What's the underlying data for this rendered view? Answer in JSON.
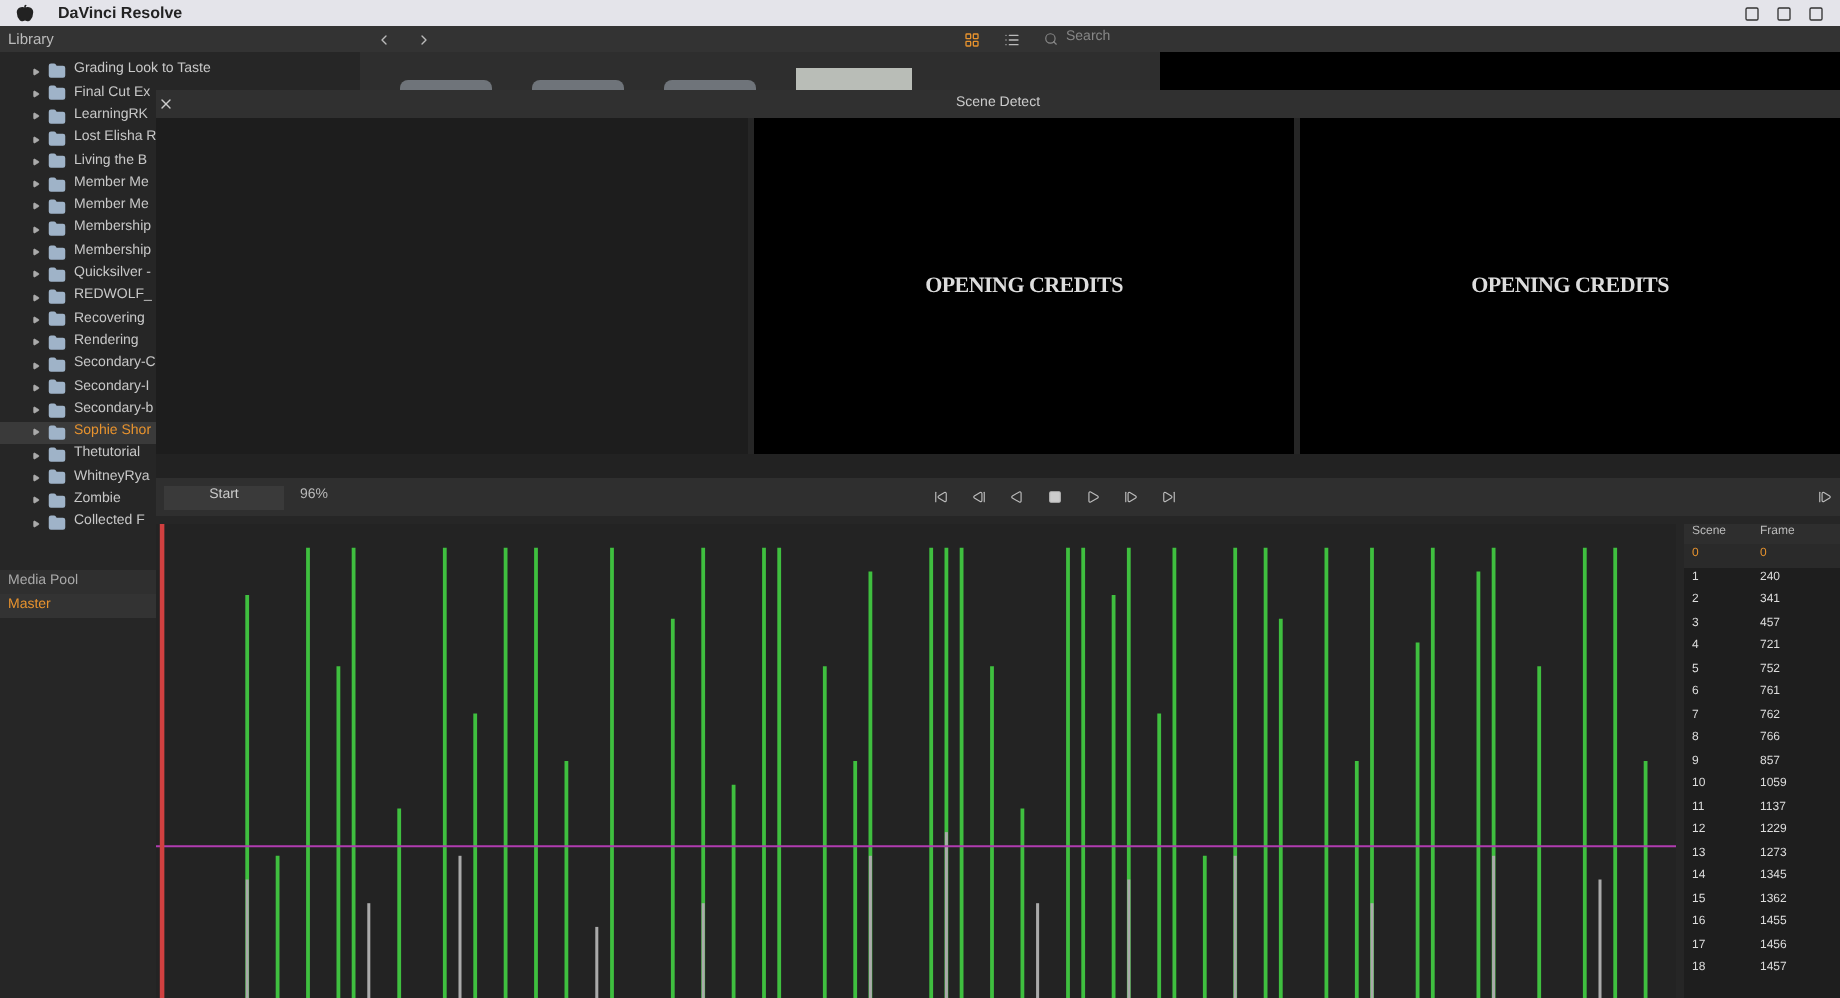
{
  "menubar": {
    "app_name": "DaVinci Resolve"
  },
  "library": {
    "title": "Library",
    "items": [
      {
        "label": "Grading Look to Taste",
        "selected": false
      },
      {
        "label": "Final Cut Ex",
        "selected": false
      },
      {
        "label": "LearningRK",
        "selected": false
      },
      {
        "label": "Lost Elisha R",
        "selected": false
      },
      {
        "label": "Living the B",
        "selected": false
      },
      {
        "label": "Member Me",
        "selected": false
      },
      {
        "label": "Member Me",
        "selected": false
      },
      {
        "label": "Membership",
        "selected": false
      },
      {
        "label": "Membership",
        "selected": false
      },
      {
        "label": "Quicksilver -",
        "selected": false
      },
      {
        "label": "REDWOLF_",
        "selected": false
      },
      {
        "label": "Recovering",
        "selected": false
      },
      {
        "label": "Rendering",
        "selected": false
      },
      {
        "label": "Secondary-C",
        "selected": false
      },
      {
        "label": "Secondary-I",
        "selected": false
      },
      {
        "label": "Secondary-b",
        "selected": false
      },
      {
        "label": "Sophie Shor",
        "selected": true
      },
      {
        "label": "Thetutorial",
        "selected": false
      },
      {
        "label": "WhitneyRya",
        "selected": false
      },
      {
        "label": "Zombie",
        "selected": false
      },
      {
        "label": "Collected F",
        "selected": false
      }
    ]
  },
  "browser": {
    "search": {
      "placeholder": "Search"
    }
  },
  "media_pool": {
    "title": "Media Pool",
    "items": [
      {
        "label": "Master",
        "selected": true
      }
    ]
  },
  "scene_detect": {
    "title": "Scene Detect",
    "previews": [
      {
        "caption": "OPENING CREDITS"
      },
      {
        "caption": "OPENING CREDITS"
      }
    ],
    "start_button": "Start",
    "progress": "96%",
    "table": {
      "columns": [
        "Scene",
        "Frame"
      ],
      "rows": [
        {
          "cells": [
            "0",
            "0"
          ],
          "selected": true
        },
        {
          "cells": [
            "1",
            "240"
          ],
          "selected": false
        },
        {
          "cells": [
            "2",
            "341"
          ],
          "selected": false
        },
        {
          "cells": [
            "3",
            "457"
          ],
          "selected": false
        },
        {
          "cells": [
            "4",
            "721"
          ],
          "selected": false
        },
        {
          "cells": [
            "5",
            "752"
          ],
          "selected": false
        },
        {
          "cells": [
            "6",
            "761"
          ],
          "selected": false
        },
        {
          "cells": [
            "7",
            "762"
          ],
          "selected": false
        },
        {
          "cells": [
            "8",
            "766"
          ],
          "selected": false
        },
        {
          "cells": [
            "9",
            "857"
          ],
          "selected": false
        },
        {
          "cells": [
            "10",
            "1059"
          ],
          "selected": false
        },
        {
          "cells": [
            "11",
            "1137"
          ],
          "selected": false
        },
        {
          "cells": [
            "12",
            "1229"
          ],
          "selected": false
        },
        {
          "cells": [
            "13",
            "1273"
          ],
          "selected": false
        },
        {
          "cells": [
            "14",
            "1345"
          ],
          "selected": false
        },
        {
          "cells": [
            "15",
            "1362"
          ],
          "selected": false
        },
        {
          "cells": [
            "16",
            "1455"
          ],
          "selected": false
        },
        {
          "cells": [
            "17",
            "1456"
          ],
          "selected": false
        },
        {
          "cells": [
            "18",
            "1457"
          ],
          "selected": false
        }
      ]
    }
  }
}
